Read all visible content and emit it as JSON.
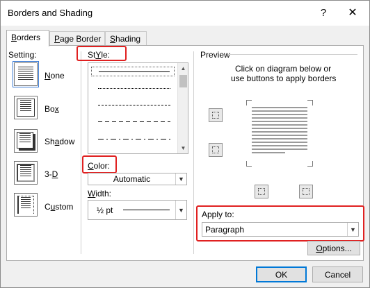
{
  "window": {
    "title": "Borders and Shading",
    "help_label": "?",
    "close_label": "✕"
  },
  "tabs": [
    {
      "prefix": "",
      "mnemonic": "B",
      "rest": "orders",
      "active": true
    },
    {
      "prefix": "",
      "mnemonic": "P",
      "rest": "age Border",
      "active": false
    },
    {
      "prefix": "",
      "mnemonic": "S",
      "rest": "hading",
      "active": false
    }
  ],
  "setting": {
    "label": "Setting:",
    "options": [
      {
        "prefix": "",
        "mnemonic": "N",
        "rest": "one",
        "icon": "setting-none-icon"
      },
      {
        "prefix": "Bo",
        "mnemonic": "x",
        "rest": "",
        "icon": "setting-box-icon"
      },
      {
        "prefix": "Sh",
        "mnemonic": "a",
        "rest": "dow",
        "icon": "setting-shadow-icon"
      },
      {
        "prefix": "3-",
        "mnemonic": "D",
        "rest": "",
        "icon": "setting-3d-icon"
      },
      {
        "prefix": "C",
        "mnemonic": "u",
        "rest": "stom",
        "icon": "setting-custom-icon"
      }
    ]
  },
  "style": {
    "label_mnemonic": "Y",
    "label_rest": ":",
    "label_prefix": "St",
    "label_after": "le",
    "styles": [
      "solid",
      "dotted",
      "fine-dashed",
      "dashed",
      "long-dashed",
      "dash-dot"
    ]
  },
  "color": {
    "label_prefix": "",
    "label_mnemonic": "C",
    "label_rest": "olor:",
    "value": "Automatic"
  },
  "width": {
    "label_prefix": "",
    "label_mnemonic": "W",
    "label_rest": "idth:",
    "value": "½ pt"
  },
  "preview": {
    "label": "Preview",
    "instructions_line1": "Click on diagram below or",
    "instructions_line2": "use buttons to apply borders"
  },
  "apply_to": {
    "label_prefix": "Apply to",
    "label_mnemonic": "",
    "label_rest": ":",
    "value": "Paragraph"
  },
  "buttons": {
    "options_prefix": "",
    "options_mnemonic": "O",
    "options_rest": "ptions...",
    "ok": "OK",
    "cancel": "Cancel"
  },
  "colors": {
    "highlight": "#e02020",
    "accent": "#0078d7"
  }
}
